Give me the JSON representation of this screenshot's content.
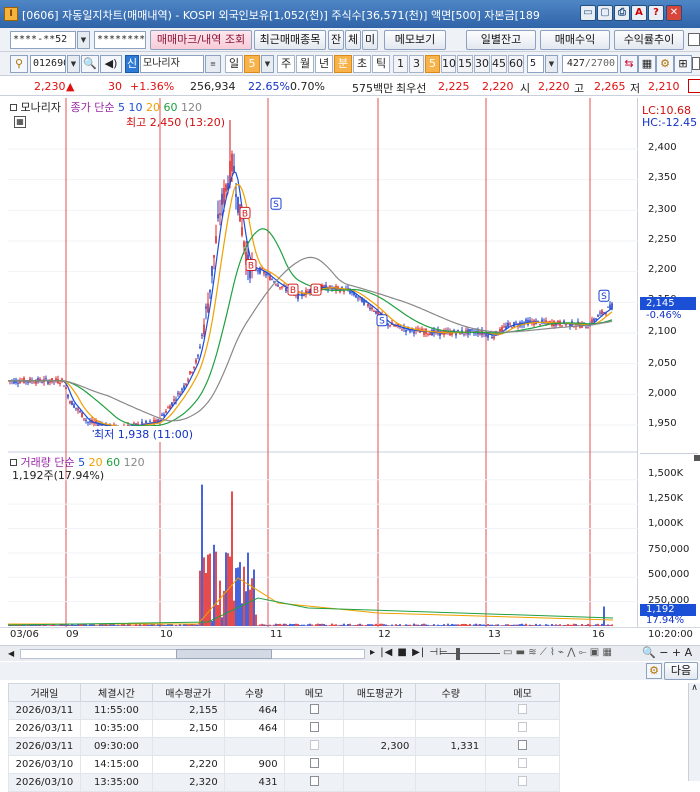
{
  "window": {
    "title": "[0606] 자동일지차트(매매내역) - KOSPI 외국인보유[1,052(천)] 주식수[36,571(천)] 액면[500] 자본금[189",
    "buttons": [
      "▭",
      "▢",
      "⎙",
      "A",
      "?",
      "✕"
    ]
  },
  "toolbar1": {
    "account": "****-**52",
    "password": "********",
    "btn_trade_mark": "매매마크/내역 조회",
    "btn_recent_items": "최근매매종목",
    "btn_balance": "잔",
    "btn_execution": "체",
    "btn_unfilled": "미",
    "btn_memo": "메모보기",
    "btn_daily_balance": "일별잔고",
    "btn_trade_profit": "매매수익",
    "btn_profit_trend": "수익률추이"
  },
  "toolbar2": {
    "code": "012690",
    "credit_tag": "신",
    "stock_name": "모나리자",
    "periods": [
      "일",
      "5",
      "주",
      "월",
      "년",
      "분",
      "초",
      "틱"
    ],
    "active_period": "분",
    "intervals": [
      "1",
      "3",
      "5",
      "10",
      "15",
      "30",
      "45",
      "60"
    ],
    "active_interval": "5",
    "interval_input": "5",
    "count_current": "427",
    "count_total": "/2700"
  },
  "quote": {
    "price": "2,230",
    "change": "30",
    "change_pct": "+1.36%",
    "volume": "256,934",
    "turnover_pct": "22.65%",
    "rate2": "0.70%",
    "amount": "575백만",
    "best_sell_label": "최우선",
    "best_sell": "2,225",
    "best_buy": "2,220",
    "open_label": "시",
    "open": "2,220",
    "high_label": "고",
    "high": "2,265",
    "low_label": "저",
    "low": "2,210"
  },
  "chart": {
    "stock_label": "모나리자",
    "price_legend": "종가 단순",
    "ma_periods": [
      "5",
      "10",
      "20",
      "60",
      "120"
    ],
    "ma_colors": [
      "#1a4fd6",
      "#1a4fd6",
      "#f0a000",
      "#20a040",
      "#888888"
    ],
    "lc_label": "LC:10.68",
    "hc_label": "HC:-12.45",
    "high_annotation": "최고 2,450 (13:20)",
    "low_annotation": "최저 1,938 (11:00)",
    "last_price_tag": "2,145",
    "last_change_tag": "-0.46%",
    "price_ticks": [
      "2,400",
      "2,350",
      "2,300",
      "2,250",
      "2,200",
      "2,150",
      "2,100",
      "2,050",
      "2,000",
      "1,950"
    ],
    "volume_legend": "거래량 단순",
    "volume_ma": [
      "5",
      "20",
      "60",
      "120"
    ],
    "volume_ma_colors": [
      "#1a4fd6",
      "#f0a000",
      "#20a040",
      "#888888"
    ],
    "volume_info": "1,192주(17.94%)",
    "volume_ticks": [
      "1,500K",
      "1,250K",
      "1,000K",
      "750,000",
      "500,000",
      "250,000"
    ],
    "last_volume_tag": "1,192",
    "last_volume_pct_tag": "17.94%",
    "dates": [
      "03/06",
      "09",
      "10",
      "11",
      "12",
      "13",
      "16"
    ],
    "time_label": "10:20:00",
    "trade_marks": [
      "B",
      "B",
      "B",
      "B",
      "S",
      "S",
      "S"
    ]
  },
  "nav": {
    "next_button": "다음"
  },
  "table": {
    "headers": [
      "거래일",
      "체결시간",
      "매수평균가",
      "수량",
      "메모",
      "매도평균가",
      "수량",
      "메모"
    ],
    "rows": [
      [
        "2026/03/11",
        "11:55:00",
        "2,155",
        "464",
        "",
        "",
        "",
        ""
      ],
      [
        "2026/03/11",
        "10:35:00",
        "2,150",
        "464",
        "",
        "",
        "",
        ""
      ],
      [
        "2026/03/11",
        "09:30:00",
        "",
        "",
        "",
        "2,300",
        "1,331",
        ""
      ],
      [
        "2026/03/10",
        "14:15:00",
        "2,220",
        "900",
        "",
        "",
        "",
        ""
      ],
      [
        "2026/03/10",
        "13:35:00",
        "2,320",
        "431",
        "",
        "",
        "",
        ""
      ]
    ]
  }
}
